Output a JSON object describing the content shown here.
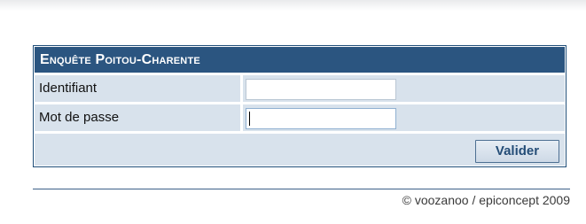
{
  "form": {
    "title": "Enquête Poitou-Charente",
    "fields": [
      {
        "label": "Identifiant",
        "value": ""
      },
      {
        "label": "Mot de passe",
        "value": ""
      }
    ],
    "submit_label": "Valider"
  },
  "footer": {
    "copyright": "© voozanoo / epiconcept 2009"
  },
  "colors": {
    "header_bg": "#2b5580",
    "row_bg": "#d8e2ec",
    "button_text": "#244d77"
  }
}
